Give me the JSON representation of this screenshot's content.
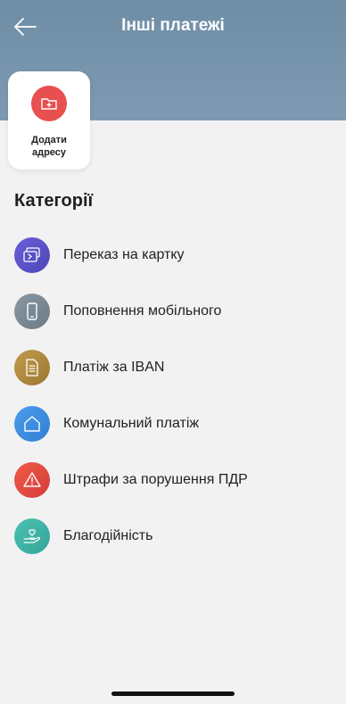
{
  "header": {
    "title": "Інші платежі",
    "back_icon": "arrow-left-icon"
  },
  "add_card": {
    "label_line1": "Додати",
    "label_line2": "адресу",
    "icon": "folder-plus-icon",
    "color": "#e8504f"
  },
  "categories": {
    "title": "Категорії",
    "items": [
      {
        "label": "Переказ на картку",
        "icon": "card-transfer-icon",
        "color": "#5c54c9"
      },
      {
        "label": "Поповнення мобільного",
        "icon": "phone-icon",
        "color": "#7d8b96"
      },
      {
        "label": "Платіж за IBAN",
        "icon": "document-icon",
        "color": "#b08a3d"
      },
      {
        "label": "Комунальний платіж",
        "icon": "home-icon",
        "color": "#3d8ee0"
      },
      {
        "label": "Штрафи за порушення ПДР",
        "icon": "warning-icon",
        "color": "#e34a3f"
      },
      {
        "label": "Благодійність",
        "icon": "charity-icon",
        "color": "#3fb5a7"
      }
    ]
  }
}
